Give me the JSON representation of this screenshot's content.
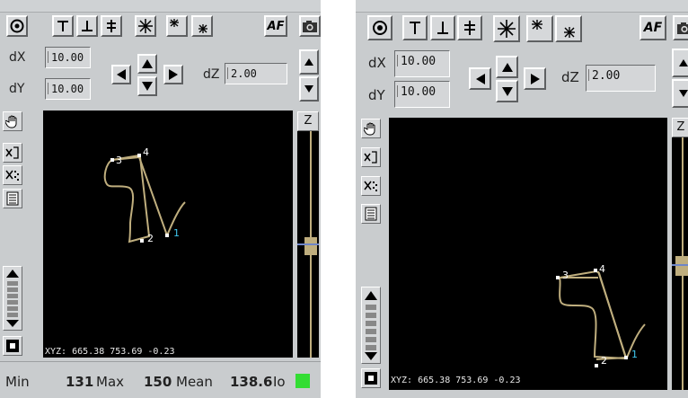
{
  "controls": {
    "af_label": "AF",
    "dx_label": "dX",
    "dy_label": "dY",
    "dz_label": "dZ",
    "dx_value": "10.00",
    "dy_value": "10.00",
    "dz_value": "2.00",
    "z_header": "Z"
  },
  "view": {
    "readout": "XYZ: 665.38 753.69 -0.23",
    "point_labels": [
      "1",
      "2",
      "3",
      "4"
    ],
    "curve_color": "#bfae7e",
    "label_color_1": "#40c8f0",
    "label_color_other": "#ffffff"
  },
  "status": {
    "min_label": "Min",
    "min_value": "131",
    "max_label": "Max",
    "max_value": "150",
    "mean_label": "Mean",
    "mean_value": "138.6",
    "io_label": "Io",
    "indicator_color": "#33dd33"
  },
  "icons": [
    "target-icon",
    "top-bar-icon",
    "bottom-bar-icon",
    "double-bar-icon",
    "star-icon",
    "star-up-icon",
    "star-down-icon",
    "camera-icon",
    "hand-icon",
    "close-box-icon",
    "scatter-icon",
    "list-icon",
    "stop-icon"
  ]
}
